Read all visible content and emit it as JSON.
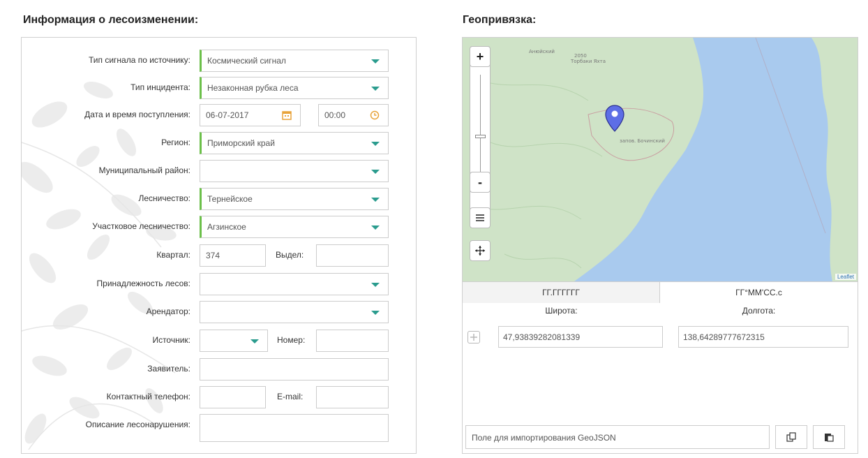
{
  "titles": {
    "left": "Информация о лесоизменении:",
    "right": "Геопривязка:"
  },
  "form": {
    "signal_type": {
      "label": "Тип сигнала по источнику:",
      "value": "Космический сигнал"
    },
    "incident_type": {
      "label": "Тип инцидента:",
      "value": "Незаконная рубка леса"
    },
    "received": {
      "label": "Дата и время поступления:",
      "date": "06-07-2017",
      "time": "00:00"
    },
    "region": {
      "label": "Регион:",
      "value": "Приморский край"
    },
    "municipal": {
      "label": "Муниципальный район:",
      "value": ""
    },
    "forestry": {
      "label": "Лесничество:",
      "value": "Тернейское"
    },
    "district_forestry": {
      "label": "Участковое лесничество:",
      "value": "Агзинское"
    },
    "quarter": {
      "label": "Квартал:",
      "value": "374"
    },
    "allotment": {
      "label": "Выдел:",
      "value": ""
    },
    "ownership": {
      "label": "Принадлежность лесов:",
      "value": ""
    },
    "tenant": {
      "label": "Арендатор:",
      "value": ""
    },
    "source": {
      "label": "Источник:",
      "value": ""
    },
    "number": {
      "label": "Номер:",
      "value": ""
    },
    "applicant": {
      "label": "Заявитель:",
      "value": ""
    },
    "phone": {
      "label": "Контактный телефон:",
      "value": ""
    },
    "email": {
      "label": "E-mail:",
      "value": ""
    },
    "description": {
      "label": "Описание лесонарушения:",
      "value": ""
    }
  },
  "map": {
    "zoom_in": "+",
    "zoom_out": "-",
    "attribution": "Leaflet",
    "place_labels": [
      "2050",
      "Торбаки Яхта",
      "Анюйский",
      "запов. Бочинский"
    ],
    "colors": {
      "land": "#cfe3c7",
      "sea": "#a9caee",
      "marker": "#5d6ee6"
    },
    "icons": [
      "layers-icon",
      "locate-icon",
      "map-marker-icon"
    ]
  },
  "coords": {
    "tab_decimal": "ГГ.ГГГГГГ",
    "tab_dms": "ГГ°ММ'СС.с",
    "lat_label": "Широта:",
    "lon_label": "Долгота:",
    "lat": "47,93839282081339",
    "lon": "138,64289777672315"
  },
  "geojson": {
    "placeholder": "Поле для импортирования GeoJSON"
  }
}
